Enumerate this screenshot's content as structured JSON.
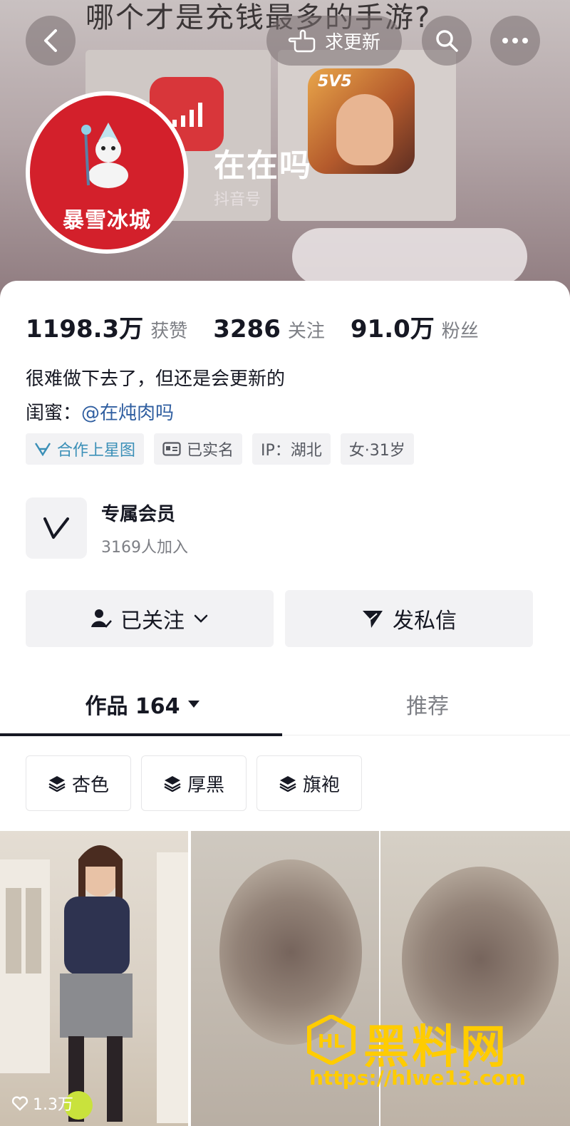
{
  "banner": {
    "background_title": "哪个才是充钱最多的手游?",
    "game_badge": "5V5"
  },
  "nav": {
    "update_label": "求更新"
  },
  "profile": {
    "avatar_text": "暴雪冰城",
    "name": "在在吗",
    "id_label": "抖音号"
  },
  "stats": [
    {
      "value": "1198.3万",
      "label": "获赞"
    },
    {
      "value": "3286",
      "label": "关注"
    },
    {
      "value": "91.0万",
      "label": "粉丝"
    }
  ],
  "bio": {
    "line1": "很难做下去了，但还是会更新的",
    "line2_prefix": "闺蜜：",
    "mention": "@在炖肉吗"
  },
  "tags": [
    {
      "label": "合作上星图",
      "icon": "star-map-icon"
    },
    {
      "label": "已实名",
      "icon": "id-card-icon"
    },
    {
      "label": "IP：湖北"
    },
    {
      "label": "女·31岁"
    }
  ],
  "member": {
    "title": "专属会员",
    "subtitle": "3169人加入"
  },
  "actions": {
    "follow_label": "已关注",
    "message_label": "发私信"
  },
  "tabs": {
    "works_label": "作品 164",
    "recommend_label": "推荐"
  },
  "collections": [
    "杏色",
    "厚黑",
    "旗袍"
  ],
  "videos": [
    {
      "likes": "1.3万"
    }
  ],
  "watermark": {
    "name": "黑料网",
    "url": "https://hlwe13.com"
  },
  "colors": {
    "avatar_red": "#d3202b",
    "mention_blue": "#2f5ea0",
    "star_tag": "#3a8fb7",
    "watermark_yellow": "#ffcc00"
  }
}
